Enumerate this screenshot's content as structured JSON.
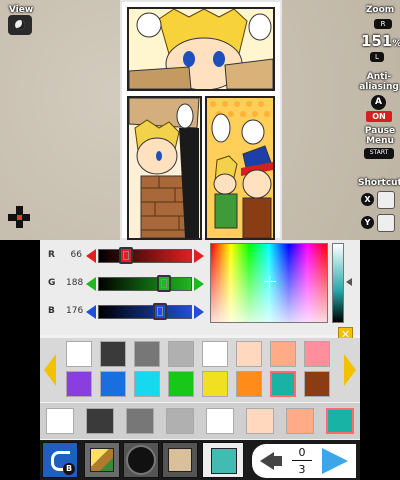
{
  "top_screen": {
    "view_label": "View",
    "zoom": {
      "label": "Zoom",
      "value": "151",
      "unit": "%",
      "key_up": "R",
      "key_down": "L"
    },
    "antialiasing": {
      "label_line1": "Anti-",
      "label_line2": "aliasing",
      "key": "A",
      "state": "ON"
    },
    "pause_menu": {
      "label_line1": "Pause",
      "label_line2": "Menu",
      "key": "START"
    },
    "shortcut": {
      "label": "Shortcut",
      "keys": [
        "X",
        "Y"
      ]
    }
  },
  "color_editor": {
    "sliders": [
      {
        "name": "R",
        "value": "66",
        "fraction": 0.26,
        "color": "#e02020"
      },
      {
        "name": "G",
        "value": "188",
        "fraction": 0.74,
        "color": "#1fb81f"
      },
      {
        "name": "B",
        "value": "176",
        "fraction": 0.69,
        "color": "#1f4fd8"
      }
    ],
    "selected_color": "#42bcb0"
  },
  "palette": [
    "#ffffff",
    "#3a3a3a",
    "#777777",
    "#b0b0b0",
    "#ffffff",
    "#ffd8bd",
    "#ffab88",
    "#ff8f9a",
    "#8a3ee0",
    "#1a6fe0",
    "#18d8f0",
    "#18c818",
    "#f0e020",
    "#ff8c1a",
    "#19b3a5",
    "#8a3c14"
  ],
  "palette_selected_index": 14,
  "recent_colors": [
    "#ffffff",
    "#3a3a3a",
    "#777777",
    "#b0b0b0",
    "#ffffff",
    "#ffd8bd",
    "#ffab88",
    "#19b3a5"
  ],
  "recent_selected_index": 7,
  "toolbar": {
    "back_key": "B",
    "layer_current": "0",
    "layer_total": "3"
  }
}
